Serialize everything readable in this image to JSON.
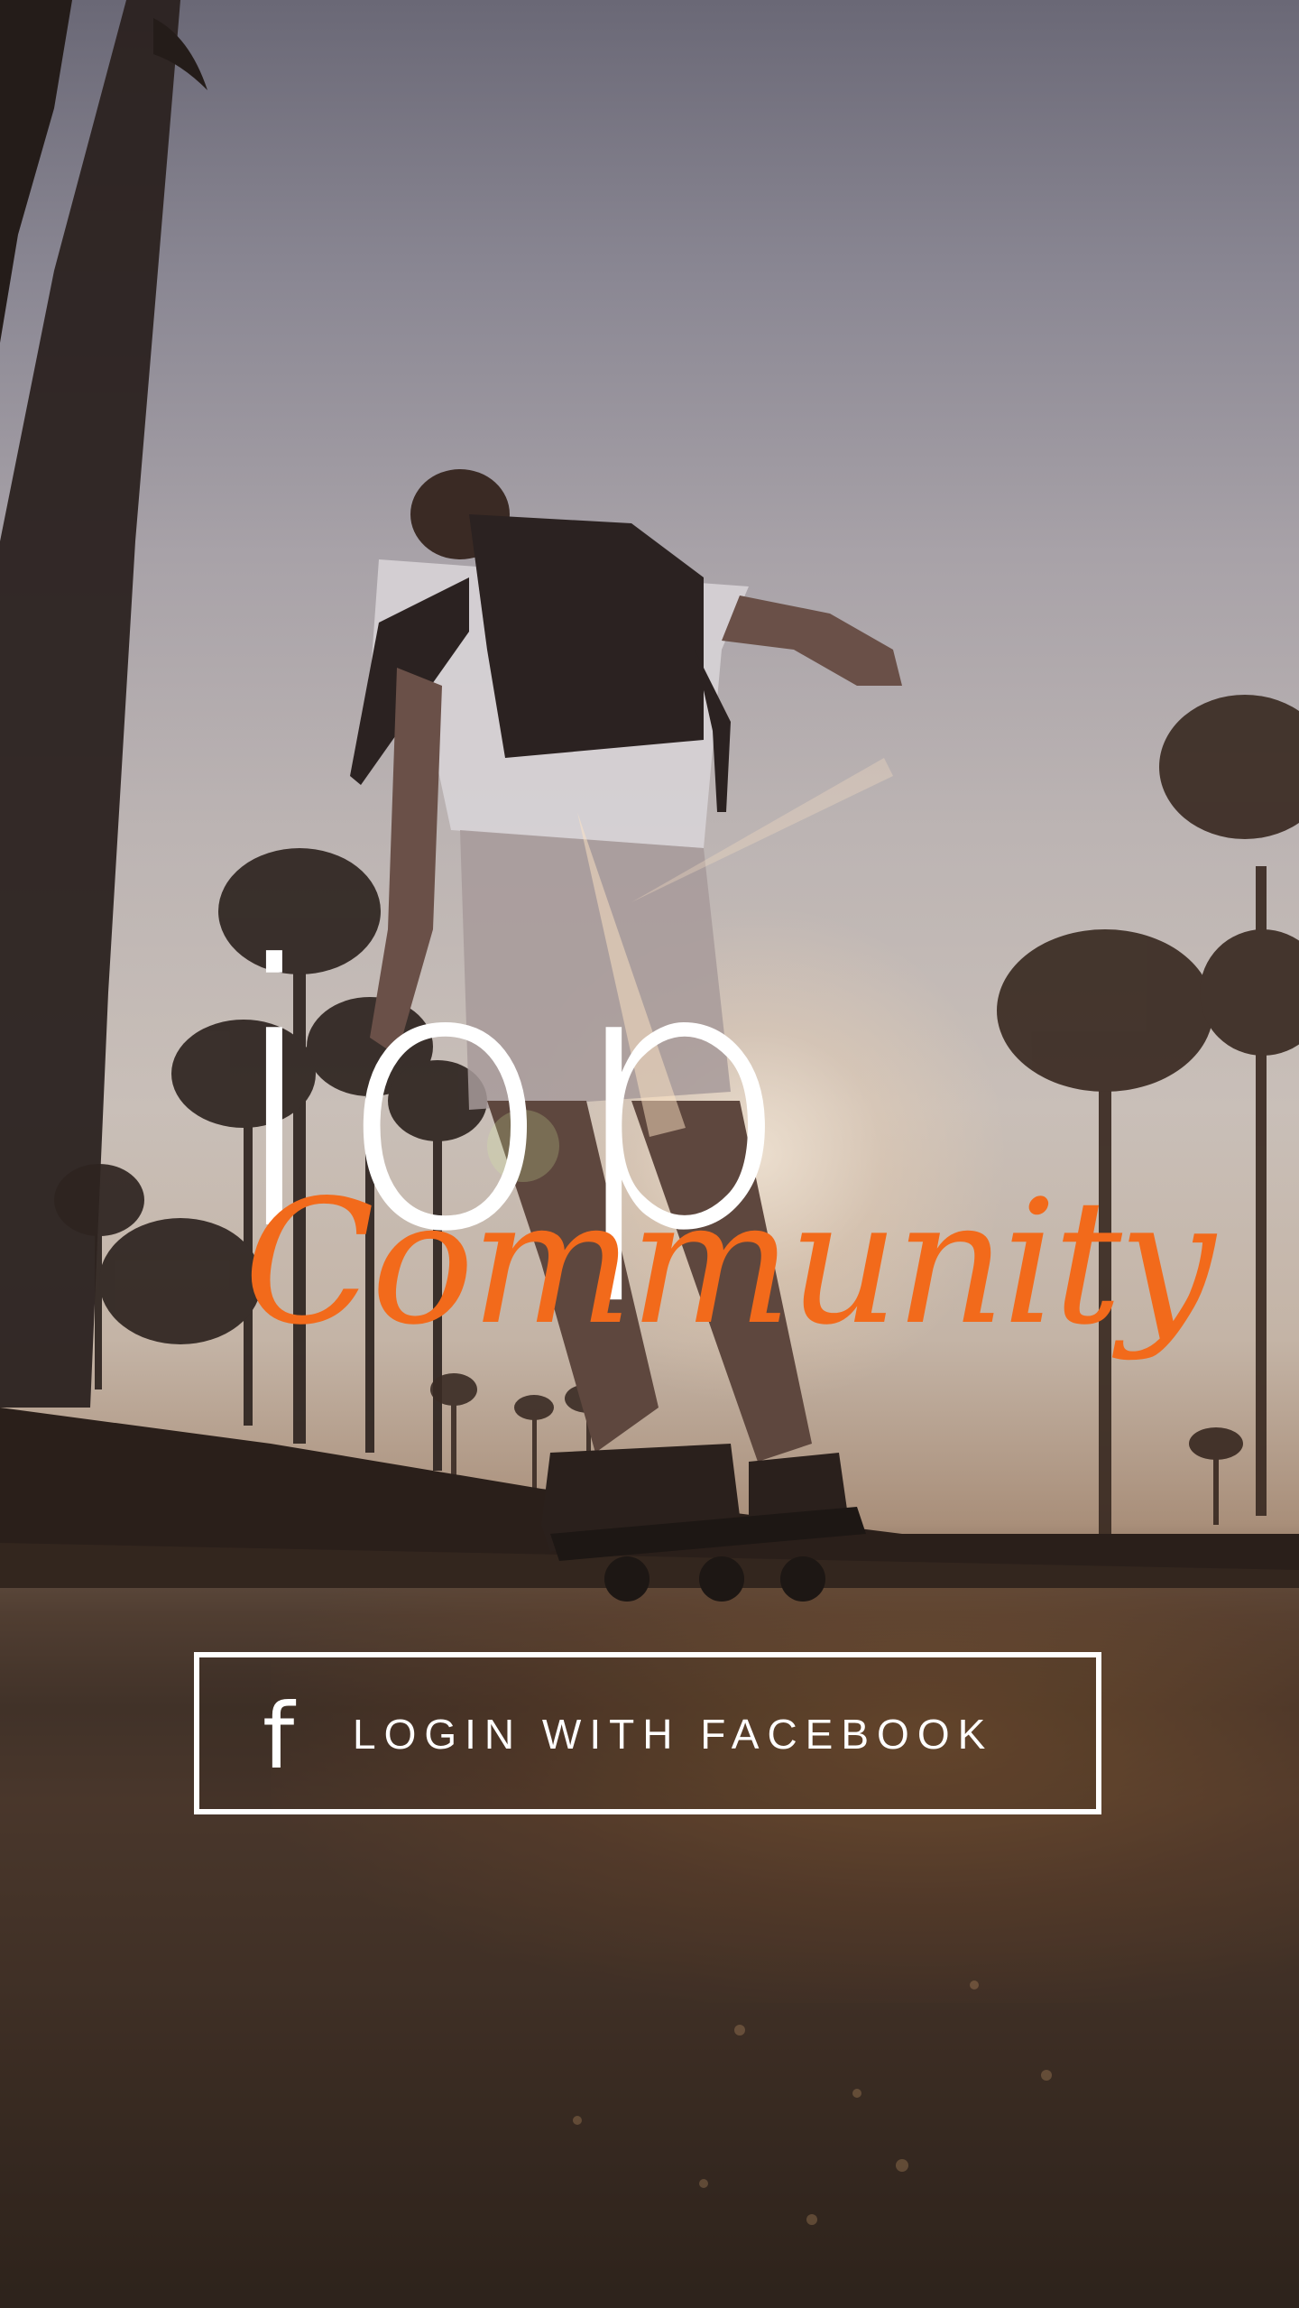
{
  "app": {
    "logo": {
      "wordmark": "iop",
      "tagline": "Community"
    },
    "login": {
      "facebook_icon": "f",
      "facebook_label": "LOGIN WITH FACEBOOK"
    }
  },
  "colors": {
    "accent": "#f26a1b",
    "button_border": "#ffffff",
    "text": "#ffffff"
  },
  "icons": {
    "facebook": "facebook-icon"
  }
}
